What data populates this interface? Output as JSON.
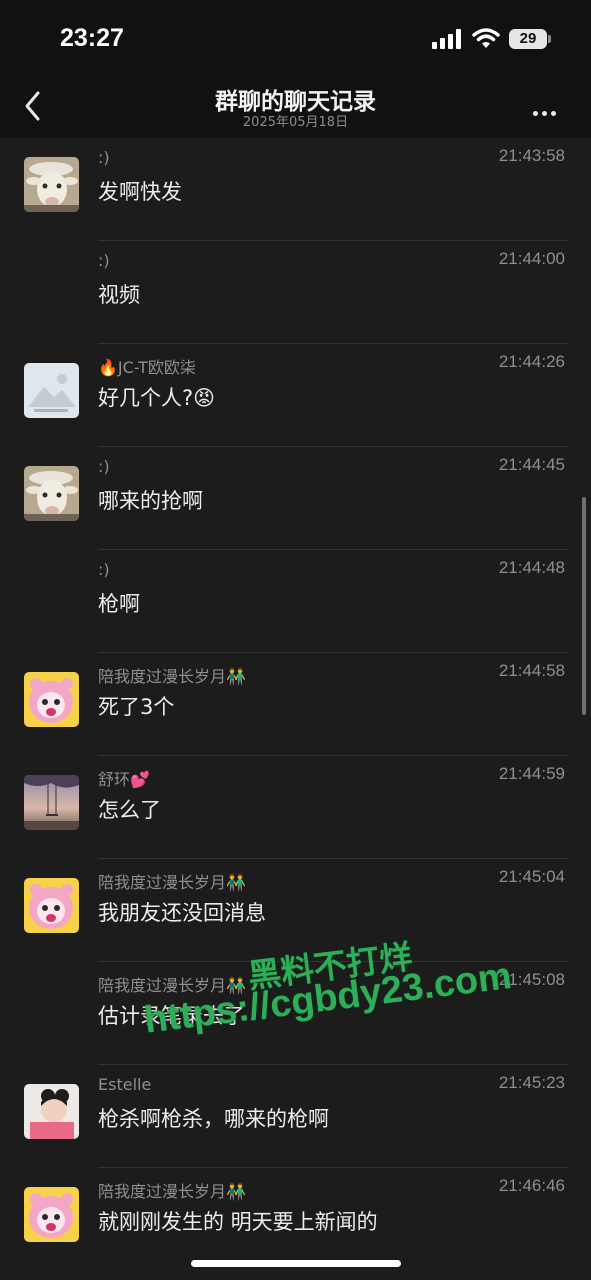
{
  "status_bar": {
    "time": "23:27",
    "battery": "29",
    "icons": [
      "signal-icon",
      "wifi-icon",
      "battery-icon"
    ]
  },
  "nav": {
    "title": "群聊的聊天记录",
    "subtitle": "2025年05月18日",
    "back_icon": "chevron-left-icon",
    "more_icon": "more-icon"
  },
  "messages": [
    {
      "sender": ":)",
      "time": "21:43:58",
      "text": "发啊快发",
      "avatar": "goat"
    },
    {
      "sender": ":)",
      "time": "21:44:00",
      "text": "视频",
      "avatar": ""
    },
    {
      "sender": "🔥JC-T欧欧柒",
      "time": "21:44:26",
      "text": "好几个人?😡",
      "avatar": "placeholder"
    },
    {
      "sender": ":)",
      "time": "21:44:45",
      "text": "哪来的抢啊",
      "avatar": "goat"
    },
    {
      "sender": ":)",
      "time": "21:44:48",
      "text": "枪啊",
      "avatar": ""
    },
    {
      "sender": "陪我度过漫长岁月👬",
      "time": "21:44:58",
      "text": "死了3个",
      "avatar": "pink-cartoon"
    },
    {
      "sender": "舒环💕",
      "time": "21:44:59",
      "text": "怎么了",
      "avatar": "sunset-swing"
    },
    {
      "sender": "陪我度过漫长岁月👬",
      "time": "21:45:04",
      "text": "我朋友还没回消息",
      "avatar": "pink-cartoon"
    },
    {
      "sender": "陪我度过漫长岁月👬",
      "time": "21:45:08",
      "text": "估计录笔录去了",
      "avatar": ""
    },
    {
      "sender": "Estelle",
      "time": "21:45:23",
      "text": "枪杀啊枪杀，哪来的枪啊",
      "avatar": "child-photo"
    },
    {
      "sender": "陪我度过漫长岁月👬",
      "time": "21:46:46",
      "text": "就刚刚发生的 明天要上新闻的",
      "avatar": "pink-cartoon"
    }
  ],
  "watermark": {
    "line1": "黑料不打烊",
    "line2": "https://cgbdy23.com"
  },
  "colors": {
    "background": "#1c1c1c",
    "header": "#111111",
    "secondary_text": "#8f8f8f",
    "watermark": "#2fae5a"
  }
}
